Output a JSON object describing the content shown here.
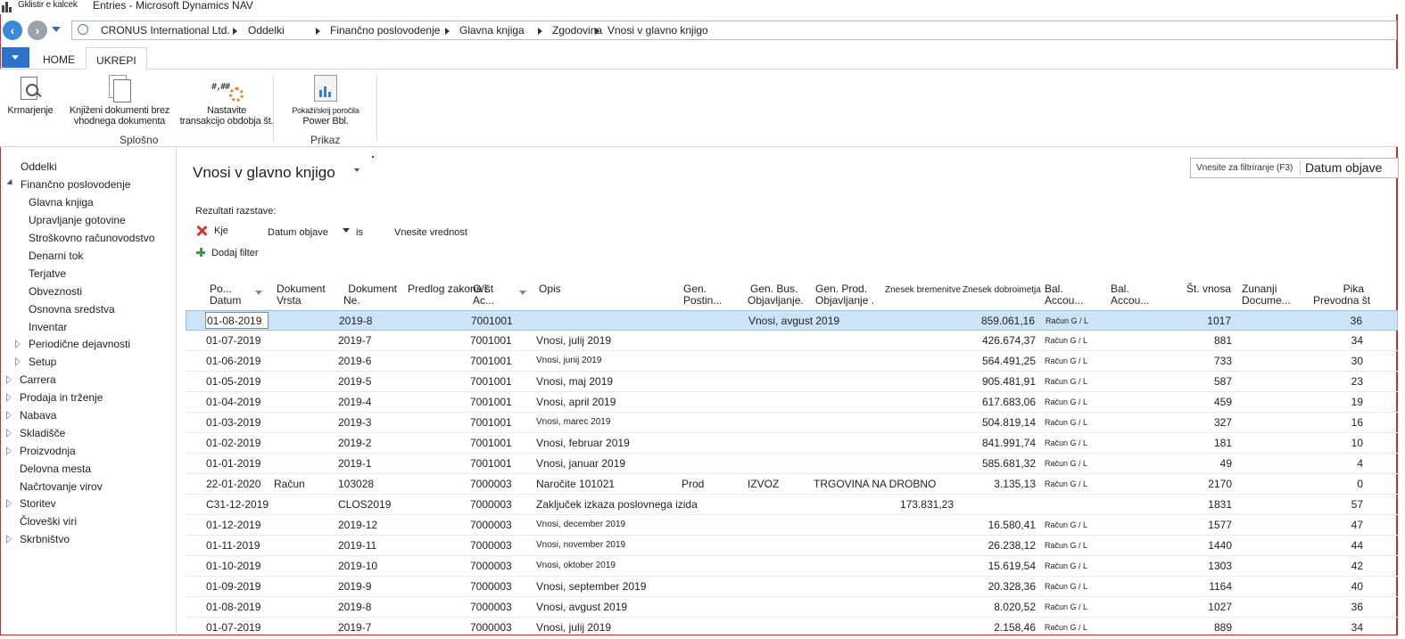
{
  "window": {
    "qa_label": "Gklistir e kalcek",
    "title": "Entries - Microsoft Dynamics NAV"
  },
  "breadcrumbs": [
    "CRONUS International Ltd.",
    "Oddelki",
    "Finančno poslovodenje",
    "Glavna knjiga",
    "Zgodovina",
    "Vnosi v glavno knjigo"
  ],
  "ribbon": {
    "tabs": [
      "HOME",
      "UKREPI"
    ],
    "active_tab": "UKREPI",
    "buttons": {
      "krmarjenje": "Krmarjenje",
      "knjizeni_1": "Knjiženi dokumenti brez",
      "knjizeni_2": "vhodnega dokumenta",
      "nastavite_1": "Nastavite",
      "nastavite_2": "transakcijo obdobja št.",
      "pokazi_1": "Pokaži/skrij poročila",
      "pokazi_2": "Power Bbl."
    },
    "groups": {
      "splosno": "Splošno",
      "prikaz": "Prikaz"
    }
  },
  "nav": {
    "oddelki": "Oddelki",
    "financno": "Finančno poslovodenje",
    "children": [
      "Glavna knjiga",
      "Upravljanje gotovine",
      "Stroškovno računovodstvo",
      "Denarni tok",
      "Terjatve",
      "Obveznosti",
      "Osnovna sredstva",
      "Inventar"
    ],
    "periodicne": "Periodične dejavnosti",
    "setup": "Setup",
    "top": [
      "Carrera",
      "Prodaja in trženje",
      "Nabava",
      "Skladišče",
      "Proizvodnja"
    ],
    "delovna": "Delovna mesta",
    "nacrtovanje": "Načrtovanje virov",
    "storitev": "Storitev",
    "cloveski": "Človeški viri",
    "skrbnistvo": "Skrbništvo"
  },
  "page": {
    "title": "Vnosi v glavno knjigo",
    "filter_placeholder": "Vnesite za filtriranje (F3)",
    "filter_field": "Datum objave",
    "results_label": "Rezultati razstave:",
    "where": "Kje",
    "field": "Datum objave",
    "op": "is",
    "value_placeholder": "Vnesite vrednost",
    "add_filter": "Dodaj filter"
  },
  "columns": {
    "po_1": "Po...",
    "po_2": "Datum",
    "dv_1": "Dokument",
    "dv_2": "Vrsta",
    "dn_1": "Dokument",
    "dn_2": "Ne.",
    "predlog": "Predlog zakona št",
    "gl_1": "G/L",
    "gl_2": "Ac...",
    "opis": "Opis",
    "gp_1": "Gen.",
    "gp_2": "Postin...",
    "gb_1": "Gen. Bus.",
    "gb_2": "Objavljanje.",
    "gpr_1": "Gen. Prod.",
    "gpr_2": "Objavljanje .",
    "breme": "Znesek bremenitve",
    "dobro": "Znesek dobroimetja",
    "ba1_1": "Bal.",
    "ba1_2": "Accou...",
    "ba2_1": "Bal.",
    "ba2_2": "Accou...",
    "st": "Št. vnosa",
    "zd_1": "Zunanji",
    "zd_2": "Docume...",
    "pika_1": "Pika",
    "pika_2": "Prevodna št"
  },
  "rows": [
    {
      "date": "01-08-2019",
      "vrsta": "",
      "doc": "2019-8",
      "gl": "7001001",
      "opis": "",
      "gp": "",
      "gb": "Vnosi, avgust 2019",
      "gpr": "",
      "breme": "",
      "dobro": "859.061,16",
      "bal": "Račun G / L",
      "st": "1017",
      "pika": "36"
    },
    {
      "date": "01-07-2019",
      "vrsta": "",
      "doc": "2019-7",
      "gl": "7001001",
      "opis": "Vnosi, julij 2019",
      "gp": "",
      "gb": "",
      "gpr": "",
      "breme": "",
      "dobro": "426.674,37",
      "bal": "Račun G / L",
      "st": "881",
      "pika": "34"
    },
    {
      "date": "01-06-2019",
      "vrsta": "",
      "doc": "2019-6",
      "gl": "7001001",
      "opis": "Vnosi, junij 2019",
      "gp": "",
      "gb": "",
      "gpr": "",
      "breme": "",
      "dobro": "564.491,25",
      "bal": "Račun G / L",
      "st": "733",
      "pika": "30"
    },
    {
      "date": "01-05-2019",
      "vrsta": "",
      "doc": "2019-5",
      "gl": "7001001",
      "opis": "Vnosi, maj 2019",
      "gp": "",
      "gb": "",
      "gpr": "",
      "breme": "",
      "dobro": "905.481,91",
      "bal": "Račun G / L",
      "st": "587",
      "pika": "23"
    },
    {
      "date": "01-04-2019",
      "vrsta": "",
      "doc": "2019-4",
      "gl": "7001001",
      "opis": "Vnosi, april 2019",
      "gp": "",
      "gb": "",
      "gpr": "",
      "breme": "",
      "dobro": "617.683,06",
      "bal": "Račun G / L",
      "st": "459",
      "pika": "19"
    },
    {
      "date": "01-03-2019",
      "vrsta": "",
      "doc": "2019-3",
      "gl": "7001001",
      "opis": "Vnosi, marec 2019",
      "gp": "",
      "gb": "",
      "gpr": "",
      "breme": "",
      "dobro": "504.819,14",
      "bal": "Račun G / L",
      "st": "327",
      "pika": "16"
    },
    {
      "date": "01-02-2019",
      "vrsta": "",
      "doc": "2019-2",
      "gl": "7001001",
      "opis": "Vnosi, februar 2019",
      "gp": "",
      "gb": "",
      "gpr": "",
      "breme": "",
      "dobro": "841.991,74",
      "bal": "Račun G / L",
      "st": "181",
      "pika": "10"
    },
    {
      "date": "01-01-2019",
      "vrsta": "",
      "doc": "2019-1",
      "gl": "7001001",
      "opis": "Vnosi, januar 2019",
      "gp": "",
      "gb": "",
      "gpr": "",
      "breme": "",
      "dobro": "585.681,32",
      "bal": "Račun G / L",
      "st": "49",
      "pika": "4"
    },
    {
      "date": "22-01-2020",
      "vrsta": "Račun",
      "doc": "103028",
      "gl": "7000003",
      "opis": "Naročite 101021",
      "gp": "Prod",
      "gb": "IZVOZ",
      "gpr": "TRGOVINA NA DROBNO",
      "breme": "",
      "dobro": "3.135,13",
      "bal": "Račun G / L",
      "st": "2170",
      "pika": "0"
    },
    {
      "date": "C31-12-2019",
      "vrsta": "",
      "doc": "CLOS2019",
      "gl": "7000003",
      "opis": "Zaključek izkaza poslovnega izida",
      "gp": "",
      "gb": "",
      "gpr": "",
      "breme": "173.831,23",
      "dobro": "",
      "bal": "",
      "st": "1831",
      "pika": "57"
    },
    {
      "date": "01-12-2019",
      "vrsta": "",
      "doc": "2019-12",
      "gl": "7000003",
      "opis": "Vnosi, december 2019",
      "gp": "",
      "gb": "",
      "gpr": "",
      "breme": "",
      "dobro": "16.580,41",
      "bal": "Račun G / L",
      "st": "1577",
      "pika": "47"
    },
    {
      "date": "01-11-2019",
      "vrsta": "",
      "doc": "2019-11",
      "gl": "7000003",
      "opis": "Vnosi, november 2019",
      "gp": "",
      "gb": "",
      "gpr": "",
      "breme": "",
      "dobro": "26.238,12",
      "bal": "Račun G / L",
      "st": "1440",
      "pika": "44"
    },
    {
      "date": "01-10-2019",
      "vrsta": "",
      "doc": "2019-10",
      "gl": "7000003",
      "opis": "Vnosi, oktober 2019",
      "gp": "",
      "gb": "",
      "gpr": "",
      "breme": "",
      "dobro": "15.619,54",
      "bal": "Račun G / L",
      "st": "1303",
      "pika": "42"
    },
    {
      "date": "01-09-2019",
      "vrsta": "",
      "doc": "2019-9",
      "gl": "7000003",
      "opis": "Vnosi, september 2019",
      "gp": "",
      "gb": "",
      "gpr": "",
      "breme": "",
      "dobro": "20.328,36",
      "bal": "Račun G / L",
      "st": "1164",
      "pika": "40"
    },
    {
      "date": "01-08-2019",
      "vrsta": "",
      "doc": "2019-8",
      "gl": "7000003",
      "opis": "Vnosi, avgust 2019",
      "gp": "",
      "gb": "",
      "gpr": "",
      "breme": "",
      "dobro": "8.020,52",
      "bal": "Račun G / L",
      "st": "1027",
      "pika": "36"
    },
    {
      "date": "01-07-2019",
      "vrsta": "",
      "doc": "2019-7",
      "gl": "7000003",
      "opis": "Vnosi, julij 2019",
      "gp": "",
      "gb": "",
      "gpr": "",
      "breme": "",
      "dobro": "2.158,46",
      "bal": "Račun G / L",
      "st": "889",
      "pika": "34"
    }
  ],
  "colors": {
    "accent": "#2a73c9",
    "selected_row": "#cde3f7",
    "delete": "#d13b2e",
    "add": "#3f9a3f"
  }
}
